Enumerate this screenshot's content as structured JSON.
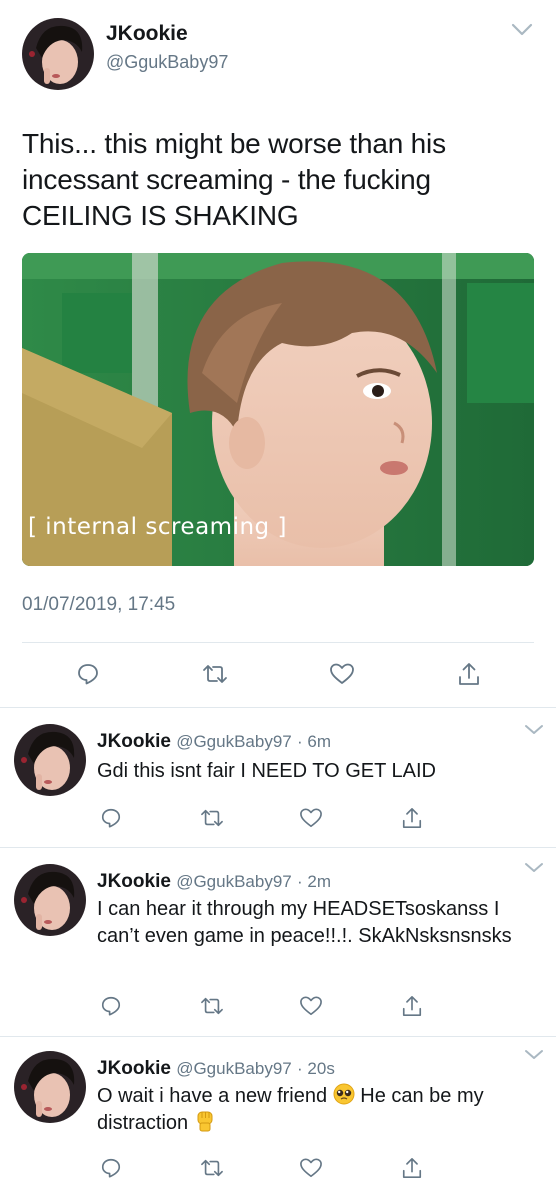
{
  "main_tweet": {
    "display_name": "JKookie",
    "handle": "@GgukBaby97",
    "text": "This... this might be worse than his incessant screaming - the fucking CEILING IS SHAKING",
    "image_caption": "[ internal screaming ]",
    "timestamp": "01/07/2019, 17:45",
    "actions": [
      "reply-icon",
      "retweet-icon",
      "like-icon",
      "share-icon"
    ]
  },
  "replies": [
    {
      "display_name": "JKookie",
      "handle": "@GgukBaby97",
      "time": "· 6m",
      "text": "Gdi this isnt fair I NEED TO GET LAID"
    },
    {
      "display_name": "JKookie",
      "handle": "@GgukBaby97",
      "time": "· 2m",
      "text": "I can hear it through my HEADSETsoskanss I can’t even game in peace!!.!. SkAkNsksnsnsks"
    },
    {
      "display_name": "JKookie",
      "handle": "@GgukBaby97",
      "time": "· 20s",
      "text_part1": "O wait i have a new friend",
      "text_part2": "He can be my distraction",
      "emoji_1": "pleading-face-emoji",
      "emoji_2": "raised-fist-emoji"
    }
  ],
  "colors": {
    "text_primary": "#14171a",
    "text_secondary": "#657786",
    "divider": "#e1e8ed",
    "icon": "#657786"
  }
}
